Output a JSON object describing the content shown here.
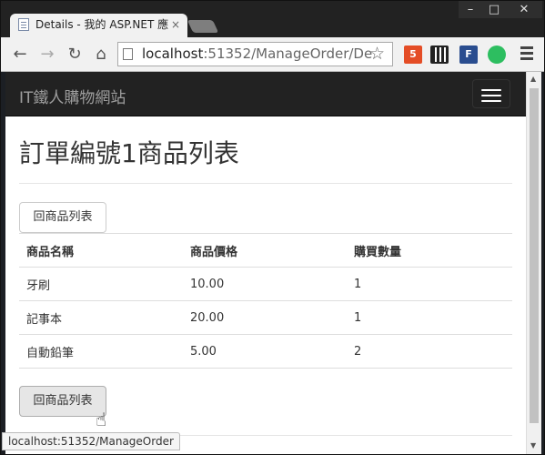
{
  "browser": {
    "tab_title": "Details - 我的 ASP.NET 應",
    "tab_close": "×",
    "url_host": "localhost",
    "url_rest": ":51352/ManageOrder/De",
    "window_controls": [
      "–",
      "□",
      "✕"
    ],
    "nav_icons": [
      "back-arrow-icon",
      "forward-arrow-icon",
      "reload-icon",
      "home-icon"
    ],
    "extensions": [
      {
        "name": "html5-extension-icon",
        "label": "5",
        "color": "#e44d26"
      },
      {
        "name": "qr-code-extension-icon",
        "label": "",
        "color": "#222222"
      },
      {
        "name": "feedly-extension-icon",
        "label": "F",
        "color": "#2a4d8f"
      },
      {
        "name": "evernote-extension-icon",
        "label": "",
        "color": "#2dbe60"
      }
    ]
  },
  "navbar": {
    "brand": "IT鐵人購物網站"
  },
  "main": {
    "heading": "訂單編號1商品列表",
    "back_button_top": "回商品列表",
    "back_button_bottom": "回商品列表",
    "table": {
      "headers": [
        "商品名稱",
        "商品價格",
        "購買數量"
      ],
      "rows": [
        [
          "牙刷",
          "10.00",
          "1"
        ],
        [
          "記事本",
          "20.00",
          "1"
        ],
        [
          "自動鉛筆",
          "5.00",
          "2"
        ]
      ]
    }
  },
  "status_bar": {
    "url": "localhost:51352/ManageOrder"
  }
}
